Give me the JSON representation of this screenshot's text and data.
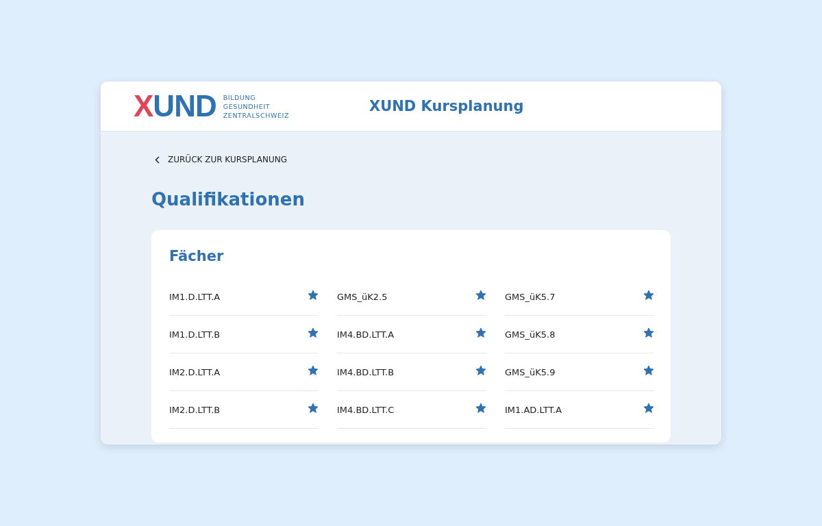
{
  "header": {
    "logo": {
      "wordmark": "XUND",
      "tagline": [
        "BILDUNG",
        "GESUNDHEIT",
        "ZENTRALSCHWEIZ"
      ]
    },
    "title": "XUND Kursplanung"
  },
  "back_link": "ZURÜCK ZUR KURSPLANUNG",
  "page_title": "Qualifikationen",
  "card": {
    "title": "Fächer",
    "columns": [
      [
        {
          "label": "IM1.D.LTT.A",
          "starred": true
        },
        {
          "label": "IM1.D.LTT.B",
          "starred": true
        },
        {
          "label": "IM2.D.LTT.A",
          "starred": true
        },
        {
          "label": "IM2.D.LTT.B",
          "starred": true
        }
      ],
      [
        {
          "label": "GMS_üK2.5",
          "starred": true
        },
        {
          "label": "IM4.BD.LTT.A",
          "starred": true
        },
        {
          "label": "IM4.BD.LTT.B",
          "starred": true
        },
        {
          "label": "IM4.BD.LTT.C",
          "starred": true
        }
      ],
      [
        {
          "label": "GMS_üK5.7",
          "starred": true
        },
        {
          "label": "GMS_üK5.8",
          "starred": true
        },
        {
          "label": "GMS_üK5.9",
          "starred": true
        },
        {
          "label": "IM1.AD.LTT.A",
          "starred": true
        }
      ]
    ]
  }
}
